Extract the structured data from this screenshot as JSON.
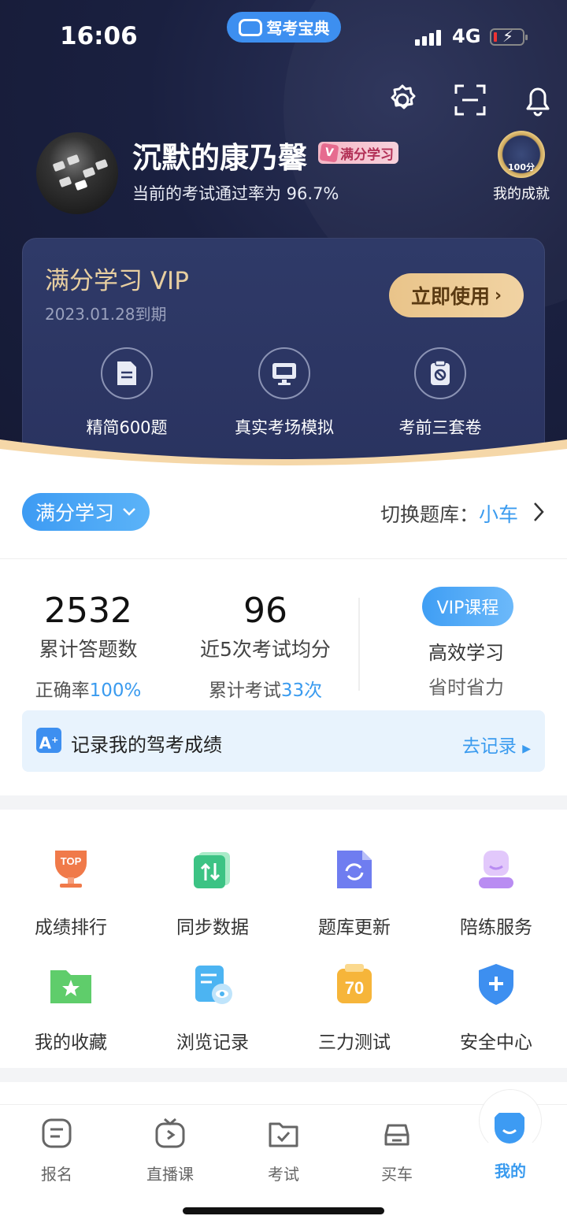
{
  "status_bar": {
    "time": "16:06",
    "app_pill": "驾考宝典",
    "network": "4G"
  },
  "profile": {
    "username": "沉默的康乃馨",
    "vip_badge": "满分学习",
    "pass_rate": "当前的考试通过率为 96.7%",
    "achievement_medal_text": "100分",
    "achievement_label": "我的成就"
  },
  "vip_card": {
    "title": "满分学习 VIP",
    "expiry": "2023.01.28到期",
    "use_button": "立即使用",
    "features": [
      {
        "label": "精简600题",
        "icon": "document-icon"
      },
      {
        "label": "真实考场模拟",
        "icon": "monitor-icon"
      },
      {
        "label": "考前三套卷",
        "icon": "clipboard-icon"
      }
    ]
  },
  "bank": {
    "mode": "满分学习",
    "switch_label": "切换题库：",
    "switch_value": "小车"
  },
  "stats": {
    "answered_count": "2532",
    "answered_label": "累计答题数",
    "accuracy_label": "正确率",
    "accuracy_value": "100%",
    "avg_score": "96",
    "avg_label": "近5次考试均分",
    "exam_count_label": "累计考试",
    "exam_count_value": "33次",
    "vip_course": "VIP课程",
    "vip_line1": "高效学习",
    "vip_line2": "省时省力"
  },
  "record": {
    "icon_letter": "A",
    "text": "记录我的驾考成绩",
    "action": "去记录"
  },
  "grid_items": [
    {
      "label": "成绩排行",
      "icon": "trophy-icon",
      "color": "#f07a4a"
    },
    {
      "label": "同步数据",
      "icon": "sync-icon",
      "color": "#3cc384"
    },
    {
      "label": "题库更新",
      "icon": "refresh-doc-icon",
      "color": "#6f7df0"
    },
    {
      "label": "陪练服务",
      "icon": "coach-icon",
      "color": "#b98cf2"
    },
    {
      "label": "我的收藏",
      "icon": "star-folder-icon",
      "color": "#5fcd6b"
    },
    {
      "label": "浏览记录",
      "icon": "eye-doc-icon",
      "color": "#4cb4f2"
    },
    {
      "label": "三力测试",
      "icon": "score-70-icon",
      "color": "#f6b53a"
    },
    {
      "label": "安全中心",
      "icon": "shield-icon",
      "color": "#3d8ff0"
    }
  ],
  "grid_extra": {
    "trophy_text": "TOP",
    "score_text": "70"
  },
  "tabs": [
    {
      "label": "报名",
      "icon": "list-icon"
    },
    {
      "label": "直播课",
      "icon": "tv-icon"
    },
    {
      "label": "考试",
      "icon": "folder-check-icon"
    },
    {
      "label": "买车",
      "icon": "car-icon"
    },
    {
      "label": "我的",
      "icon": "smile-icon",
      "active": true
    }
  ],
  "colors": {
    "accent": "#3a9bef",
    "header_bg": "#1a2040",
    "gold": "#e9c48a"
  }
}
